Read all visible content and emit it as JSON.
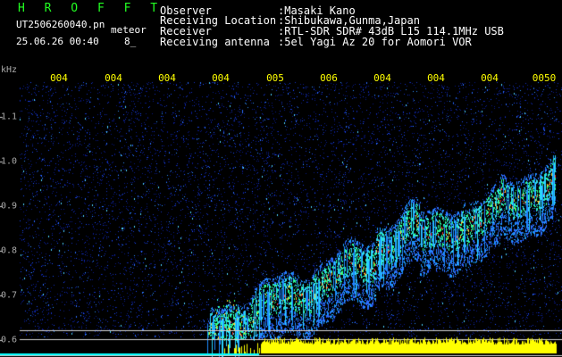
{
  "header": {
    "brand": "H R O F F T",
    "filename": "UT2506260040.pn",
    "suffix": "meteor",
    "datetime": "25.06.26 00:40",
    "page_num": "8_"
  },
  "metadata": [
    {
      "label": "Observer",
      "value": ":Masaki Kano"
    },
    {
      "label": "Receiving Location",
      "value": ":Shibukawa,Gunma,Japan"
    },
    {
      "label": "Receiver",
      "value": ":RTL-SDR SDR# 43dB L15 114.1MHz USB"
    },
    {
      "label": "Receiving antenna",
      "value": ":5el Yagi Az 20 for Aomori VOR"
    }
  ],
  "colors": {
    "brand": "#22ff22",
    "text": "#ffffff",
    "axis_labels": "#ffff00",
    "axis_y": "#aaaaaa",
    "guide_lines": "#d0d0d0",
    "signal_bar": "#ffff00",
    "baseline": "#00ffff"
  },
  "axes": {
    "y_unit": "kHz",
    "y_ticks": [
      "1.1",
      "1.0",
      "0.9",
      "0.8",
      "0.7",
      "0.6"
    ],
    "x_ticks": [
      "004",
      "004",
      "004",
      "004",
      "005",
      "006",
      "004",
      "004",
      "004",
      "0050"
    ]
  }
}
